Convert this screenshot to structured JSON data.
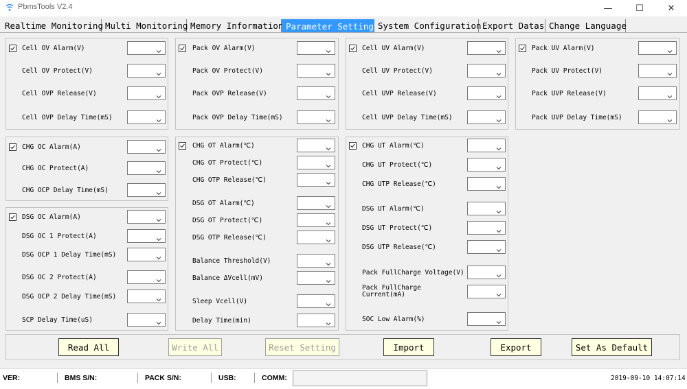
{
  "app": {
    "title": "PbmsTools V2.4",
    "icon": "app-icon"
  },
  "window": {
    "minimize": "—",
    "maximize": "☐",
    "close": "✕"
  },
  "tabs": [
    {
      "label": "Realtime Monitoring",
      "active": false
    },
    {
      "label": "Multi Monitoring",
      "active": false
    },
    {
      "label": "Memory Information",
      "active": false
    },
    {
      "label": "Parameter Setting",
      "active": true
    },
    {
      "label": "System Configuration",
      "active": false
    },
    {
      "label": "Export Datas",
      "active": false
    },
    {
      "label": "Change Language",
      "active": false
    }
  ],
  "groups": {
    "cell_ov": {
      "check": "Cell OV Alarm(V)",
      "rows": [
        "Cell OV Protect(V)",
        "Cell OVP Release(V)",
        "Cell OVP Delay Time(mS)"
      ]
    },
    "pack_ov": {
      "check": "Pack OV Alarm(V)",
      "rows": [
        "Pack OV Protect(V)",
        "Pack OVP Release(V)",
        "Pack OVP Delay Time(mS)"
      ]
    },
    "cell_uv": {
      "check": "Cell UV Alarm(V)",
      "rows": [
        "Cell UV Protect(V)",
        "Cell UVP Release(V)",
        "Cell UVP Delay Time(mS)"
      ]
    },
    "pack_uv": {
      "check": "Pack UV Alarm(V)",
      "rows": [
        "Pack UV Protect(V)",
        "Pack UVP Release(V)",
        "Pack UVP Delay Time(mS)"
      ]
    },
    "chg_oc": {
      "check": "CHG OC Alarm(A)",
      "rows": [
        "CHG OC Protect(A)",
        "CHG OCP Delay Time(mS)"
      ]
    },
    "dsg_oc": {
      "check": "DSG OC Alarm(A)",
      "rows": [
        "DSG OC 1 Protect(A)",
        "DSG OCP 1 Delay Time(mS)",
        "DSG OC 2 Protect(A)",
        "DSG OCP 2 Delay Time(mS)",
        "SCP Delay Time(uS)"
      ]
    },
    "temp_ot": {
      "check": "CHG OT Alarm(℃)",
      "rows": [
        "CHG OT Protect(℃)",
        "CHG OTP Release(℃)",
        "DSG OT Alarm(℃)",
        "DSG OT Protect(℃)",
        "DSG OTP Release(℃)",
        "Balance Threshold(V)",
        "Balance ΔVcell(mV)",
        "Sleep Vcell(V)",
        "Delay Time(min)"
      ]
    },
    "temp_ut": {
      "check": "CHG UT Alarm(℃)",
      "rows": [
        "CHG UT Protect(℃)",
        "CHG UTP Release(℃)",
        "DSG UT Alarm(℃)",
        "DSG UT Protect(℃)",
        "DSG UTP Release(℃)",
        "Pack FullCharge Voltage(V)",
        "Pack FullCharge\nCurrent(mA)",
        "SOC Low Alarm(%)"
      ]
    }
  },
  "buttons": {
    "read_all": "Read All",
    "write_all": "Write All",
    "reset_setting": "Reset Setting",
    "import": "Import",
    "export": "Export",
    "set_default": "Set As Default"
  },
  "status": {
    "ver": "VER:",
    "bms_sn": "BMS S/N:",
    "pack_sn": "PACK S/N:",
    "usb": "USB:",
    "comm": "COMM:",
    "datetime": "2019-09-10 14:07:14"
  }
}
